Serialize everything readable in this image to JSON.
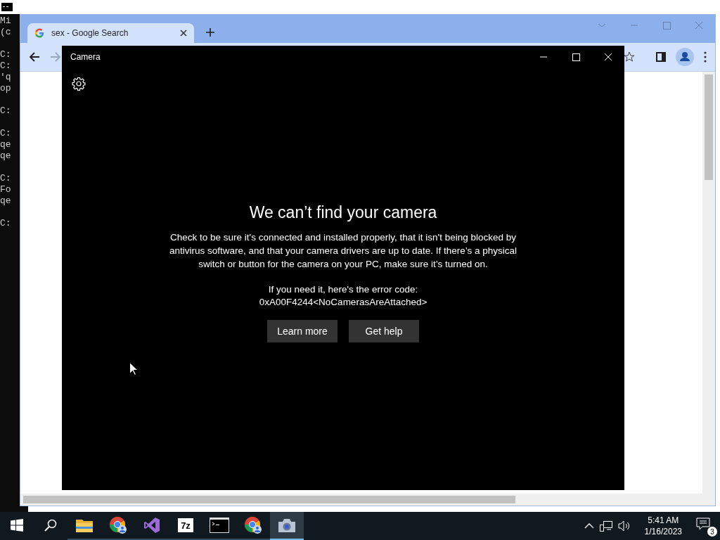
{
  "console": {
    "blocks": [
      [
        "Mi",
        "(c"
      ],
      [
        "C:",
        "C:",
        "'q",
        "op"
      ],
      [
        "C:"
      ],
      [
        "C:",
        "qe",
        "qe"
      ],
      [
        "C:",
        "Fo",
        "qe"
      ],
      [
        "C:"
      ]
    ]
  },
  "browser": {
    "tab": {
      "title": "sex - Google Search"
    },
    "nav": [
      {
        "kind": "back",
        "disabled": false
      },
      {
        "kind": "forward",
        "disabled": true
      }
    ]
  },
  "camera": {
    "title": "Camera",
    "heading": "We can’t find your camera",
    "body": "Check to be sure it's connected and installed properly, that it isn't being blocked by antivirus software, and that your camera drivers are up to date. If there’s a physical switch or button for the camera on your PC, make sure it’s turned on.",
    "error_label": "If you need it, here's the error code:",
    "error_code": "0xA00F4244<NoCamerasAreAttached>",
    "buttons": [
      "Learn more",
      "Get help"
    ]
  },
  "taskbar": {
    "items": [
      {
        "kind": "start",
        "running": false,
        "selected": false
      },
      {
        "kind": "search",
        "running": false,
        "selected": false
      },
      {
        "kind": "folder",
        "running": true,
        "selected": false
      },
      {
        "kind": "chrome",
        "running": true,
        "selected": false
      },
      {
        "kind": "studio",
        "running": true,
        "selected": false
      },
      {
        "kind": "zip",
        "label": "7z",
        "running": true,
        "selected": false
      },
      {
        "kind": "terminal",
        "running": true,
        "selected": false
      },
      {
        "kind": "chrome",
        "running": true,
        "selected": false
      },
      {
        "kind": "camera",
        "running": true,
        "selected": true
      }
    ],
    "time": "5:41 AM",
    "date": "1/16/2023",
    "notifications": "3"
  }
}
